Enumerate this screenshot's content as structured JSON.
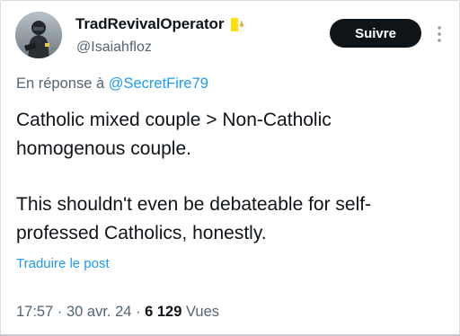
{
  "author": {
    "display_name": "TradRevivalOperator",
    "handle": "@Isaiahfloz",
    "flag_icon": "vatican-flag-icon"
  },
  "follow_button": {
    "label": "Suivre"
  },
  "more_menu": {
    "icon": "more-vertical-icon"
  },
  "reply": {
    "prefix": "En réponse à ",
    "target": "@SecretFire79"
  },
  "tweet": {
    "paragraphs": [
      "Catholic mixed couple > Non-Catholic homogenous couple.",
      "This shouldn't even be debateable for self-professed Catholics, honestly."
    ]
  },
  "translate_link": "Traduire le post",
  "meta": {
    "time": "17:57",
    "sep1": " · ",
    "date": "30 avr. 24",
    "sep2": " · ",
    "views_count": "6 129",
    "views_label": " Vues"
  },
  "colors": {
    "text": "#0f1419",
    "secondary": "#536471",
    "link": "#1d9bf0",
    "button_bg": "#0f1419"
  }
}
